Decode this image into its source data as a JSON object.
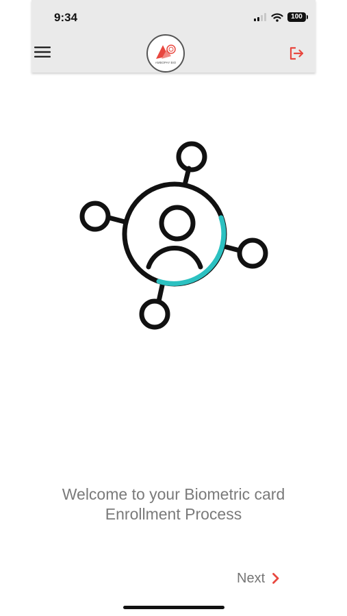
{
  "status_bar": {
    "time": "9:34",
    "battery": "100"
  },
  "header": {
    "logo_text": "AMBOPAY BIO"
  },
  "welcome": {
    "line1": "Welcome to your Biometric card",
    "line2": "Enrollment Process"
  },
  "next_button": {
    "label": "Next"
  },
  "colors": {
    "accent_red": "#e8473f",
    "teal": "#2cc1c1",
    "header_bg": "#eaeaea",
    "text_gray": "#7a7a7a"
  },
  "icons": [
    "menu-icon",
    "logout-icon",
    "biometric-network-icon",
    "chevron-right-icon",
    "wifi-icon",
    "signal-icon",
    "battery-icon"
  ]
}
